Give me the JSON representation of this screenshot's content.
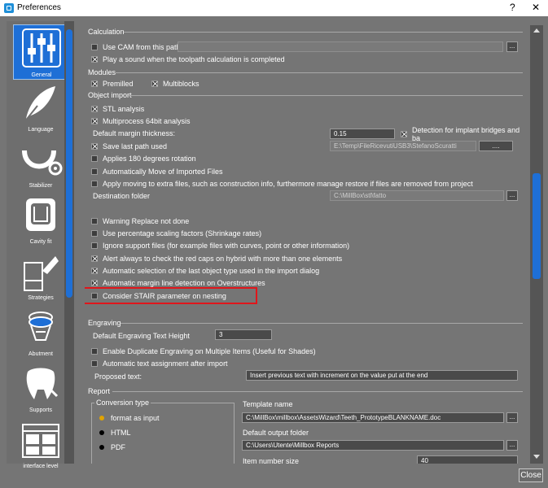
{
  "window": {
    "title": "Preferences",
    "help": "?",
    "close": "✕"
  },
  "sidebar": {
    "items": [
      {
        "label": "General",
        "icon": "sliders-icon"
      },
      {
        "label": "Language",
        "icon": "quill-icon"
      },
      {
        "label": "Stabilizer",
        "icon": "dental-arch-icon"
      },
      {
        "label": "Cavity fit",
        "icon": "tooth-cavity-icon"
      },
      {
        "label": "Strategies",
        "icon": "strategy-icon"
      },
      {
        "label": "Abutment",
        "icon": "abutment-icon"
      },
      {
        "label": "Supports",
        "icon": "tooth-support-icon"
      },
      {
        "label": "interface level",
        "icon": "layout-icon"
      }
    ]
  },
  "calculation": {
    "title": "Calculation",
    "use_cam": "Use CAM from this path:",
    "cam_path": "",
    "play_sound": "Play a sound when the toolpath calculation is completed"
  },
  "modules": {
    "title": "Modules",
    "premilled": "Premilled",
    "multiblocks": "Multiblocks"
  },
  "object_import": {
    "title": "Object import",
    "stl_analysis": "STL analysis",
    "multiprocess": "Multiprocess 64bit analysis",
    "default_margin_label": "Default margin thickness:",
    "default_margin_value": "0.15",
    "detection": "Detection for implant bridges and ba",
    "save_last_path": "Save last path used",
    "last_path_value": "E:\\Temp\\FileRicevutiUSB3\\StefanoScuratti",
    "last_path_btn": "....",
    "applies_180": "Applies 180 degrees rotation",
    "auto_move": "Automatically Move of Imported Files",
    "apply_moving": "Apply moving to extra files, such as construction info, furthermore manage restore if files are removed from project",
    "destination_label": "Destination folder",
    "destination_value": "C:\\MillBox\\stl\\fatto",
    "warning_replace": "Warning Replace not done",
    "use_percentage": "Use percentage scaling factors (Shrinkage rates)",
    "ignore_support": "Ignore support files (for example files with curves, point or other information)",
    "alert_red_caps": "Alert always to check the red caps on hybrid with more than one elements",
    "auto_selection": "Automatic selection of the last object type used in the import dialog",
    "auto_margin": "Automatic margin line detection on Overstructures",
    "consider_stair": "Consider STAIR parameter on nesting"
  },
  "engraving": {
    "title": "Engraving",
    "height_label": "Default Engraving Text Height",
    "height_value": "3",
    "enable_duplicate": "Enable Duplicate Engraving on Multiple Items (Useful for Shades)",
    "auto_text": "Automatic text assignment after import",
    "proposed_label": "Proposed text:",
    "proposed_value": "Insert previous text with increment on the value put at the end"
  },
  "report": {
    "title": "Report",
    "conversion_title": "Conversion type",
    "options": [
      "format as input",
      "HTML",
      "PDF"
    ],
    "template_label": "Template name",
    "template_value": "C:\\MillBox\\millbox\\AssetsWizard\\Teeth_PrototypeBLANKNAME.doc",
    "output_label": "Default output folder",
    "output_value": "C:\\Users\\Utente\\Millbox Reports",
    "item_size_label": "Item number size",
    "item_size_value": "40"
  },
  "footer": {
    "close": "Close"
  },
  "colors": {
    "accent": "#1e6fd6",
    "panel": "#757575",
    "highlight": "#e0161b"
  }
}
